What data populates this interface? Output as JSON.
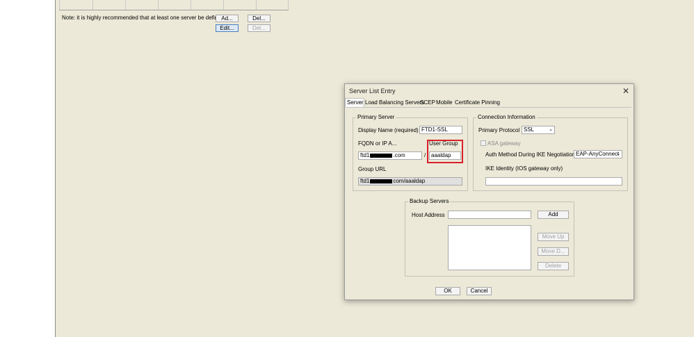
{
  "background": {
    "note": "Note: it is highly recommended that at least one server be defined in",
    "buttons": {
      "add": "Ad...",
      "delete": "Del...",
      "edit": "Edit...",
      "details": "Det..."
    }
  },
  "dialog": {
    "title": "Server List Entry",
    "close_glyph": "✕",
    "tabs": [
      "Server",
      "Load Balancing Servers",
      "SCEP",
      "Mobile",
      "Certificate Pinning"
    ],
    "selected_tab": "Server",
    "primary_server": {
      "group_label": "Primary Server",
      "display_name_label": "Display Name (required)",
      "display_name_value": "FTD1-SSL",
      "fqdn_label": "FQDN or IP A...",
      "user_group_label": "User Group",
      "fqdn_prefix": "ftd1",
      "fqdn_suffix": ".com",
      "separator": "/",
      "user_group_value": "aaaldap",
      "group_url_label": "Group URL",
      "group_url_prefix": "ftd1",
      "group_url_suffix": "com/aaaldap"
    },
    "connection_info": {
      "group_label": "Connection Information",
      "primary_protocol_label": "Primary Protocol",
      "primary_protocol_value": "SSL",
      "asa_gateway_label": "ASA gateway",
      "auth_method_label": "Auth Method During IKE Negotiation",
      "auth_method_value": "EAP-AnyConnect",
      "ike_identity_label": "IKE Identity (IOS gateway only)",
      "ike_identity_value": ""
    },
    "backup_servers": {
      "group_label": "Backup Servers",
      "host_address_label": "Host Address",
      "host_address_value": "",
      "add_label": "Add",
      "move_up_label": "Move Up",
      "move_down_label": "Move D...",
      "delete_label": "Delete"
    },
    "ok_label": "OK",
    "cancel_label": "Cancel"
  },
  "colors": {
    "highlight": "#d8202a",
    "panel": "#ece9d8"
  }
}
